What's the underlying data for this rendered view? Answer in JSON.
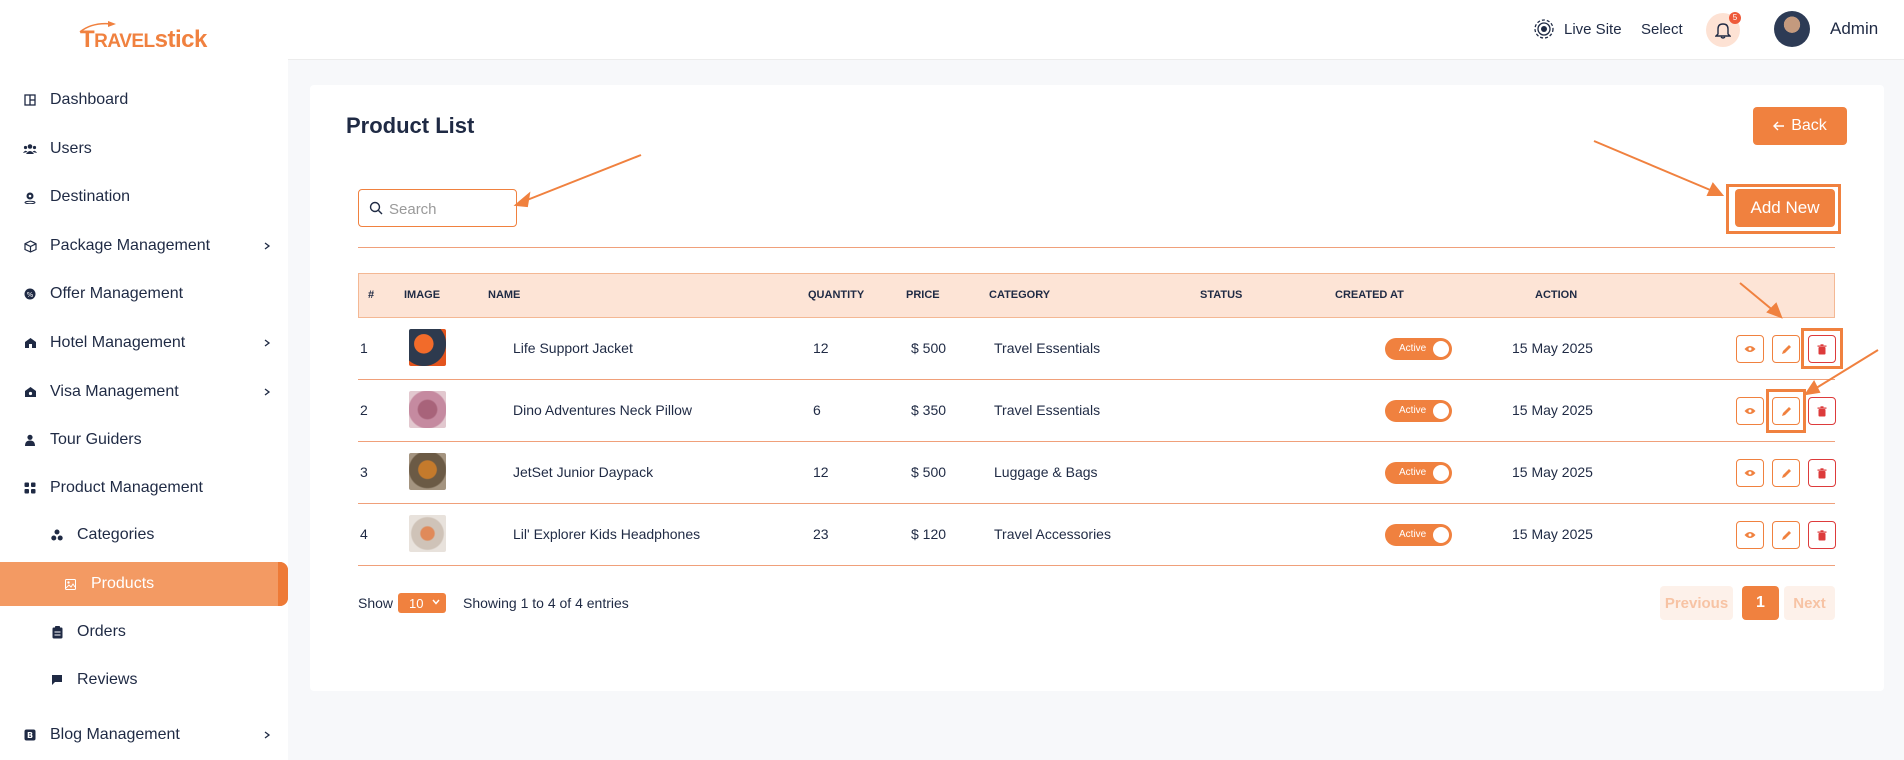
{
  "brand": {
    "logo_text_cap": "T",
    "logo_text_ravel": "RAVEL",
    "logo_text_stick": "stick"
  },
  "sidebar": {
    "items": [
      {
        "label": "Dashboard",
        "icon": "dashboard-icon"
      },
      {
        "label": "Users",
        "icon": "users-icon"
      },
      {
        "label": "Destination",
        "icon": "location-pin-icon"
      },
      {
        "label": "Package Management",
        "icon": "box-icon",
        "has_submenu": true
      },
      {
        "label": "Offer Management",
        "icon": "offer-icon"
      },
      {
        "label": "Hotel Management",
        "icon": "hotel-icon",
        "has_submenu": true
      },
      {
        "label": "Visa Management",
        "icon": "visa-icon",
        "has_submenu": true
      },
      {
        "label": "Tour Guiders",
        "icon": "person-icon"
      },
      {
        "label": "Product Management",
        "icon": "grid-icon",
        "expanded": true
      },
      {
        "label": "Categories",
        "icon": "categories-icon"
      },
      {
        "label": "Products",
        "icon": "products-icon",
        "active": true
      },
      {
        "label": "Orders",
        "icon": "clipboard-icon"
      },
      {
        "label": "Reviews",
        "icon": "comment-icon"
      },
      {
        "label": "Blog Management",
        "icon": "blog-icon",
        "has_submenu": true
      }
    ]
  },
  "header": {
    "live_site": "Live Site",
    "select": "Select",
    "notification_count": "5",
    "user_name": "Admin"
  },
  "page": {
    "title": "Product List",
    "back_label": "Back",
    "add_new_label": "Add New",
    "search_placeholder": "Search"
  },
  "table": {
    "columns": [
      "#",
      "IMAGE",
      "NAME",
      "QUANTITY",
      "PRICE",
      "CATEGORY",
      "STATUS",
      "CREATED AT",
      "ACTION"
    ],
    "rows": [
      {
        "num": "1",
        "name": "Life Support Jacket",
        "quantity": "12",
        "price": "$ 500",
        "category": "Travel Essentials",
        "status": "Active",
        "created_at": "15 May 2025"
      },
      {
        "num": "2",
        "name": "Dino Adventures Neck Pillow",
        "quantity": "6",
        "price": "$ 350",
        "category": "Travel Essentials",
        "status": "Active",
        "created_at": "15 May 2025"
      },
      {
        "num": "3",
        "name": "JetSet Junior Daypack",
        "quantity": "12",
        "price": "$ 500",
        "category": "Luggage & Bags",
        "status": "Active",
        "created_at": "15 May 2025"
      },
      {
        "num": "4",
        "name": "Lil' Explorer Kids Headphones",
        "quantity": "23",
        "price": "$ 120",
        "category": "Travel Accessories",
        "status": "Active",
        "created_at": "15 May 2025"
      }
    ]
  },
  "footer": {
    "show_label": "Show",
    "page_size": "10",
    "entries_text": "Showing 1 to 4 of 4 entries",
    "previous": "Previous",
    "current_page": "1",
    "next": "Next"
  },
  "colors": {
    "accent": "#f0813f",
    "danger": "#dd3b3b",
    "header_row": "#fde4d6"
  }
}
